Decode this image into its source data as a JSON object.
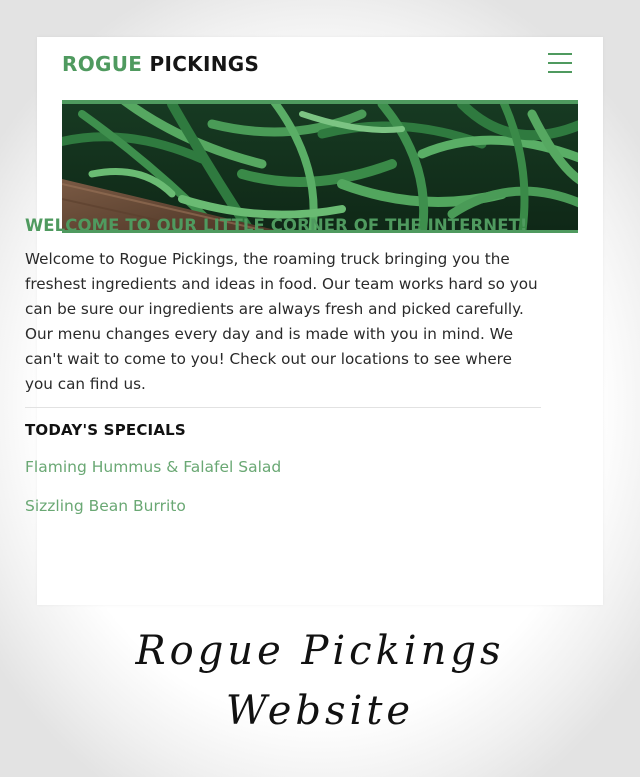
{
  "header": {
    "logo_part1": "ROGUE",
    "logo_part2": "PICKINGS",
    "menu_icon": "hamburger-menu-icon"
  },
  "hero": {
    "image": "green-beans-photo"
  },
  "welcome": {
    "heading": "WELCOME TO OUR LITTLE CORNER OF THE INTERNET!",
    "body": "Welcome to Rogue Pickings, the roaming truck bringing you the freshest ingredients and ideas in food. Our team works hard so you can be sure our ingredients are always fresh and picked carefully. Our menu changes every day and is made with you in mind. We can't wait to come to you! Check out our locations to see where you can find us."
  },
  "specials": {
    "title": "TODAY'S SPECIALS",
    "items": [
      "Flaming Hummus & Falafel Salad",
      "Sizzling Bean Burrito"
    ]
  },
  "caption": {
    "line1": "Rogue Pickings",
    "line2": "Website"
  },
  "colors": {
    "accent": "#4f9a5f",
    "link": "#6aa874",
    "text": "#2a2a2a"
  }
}
